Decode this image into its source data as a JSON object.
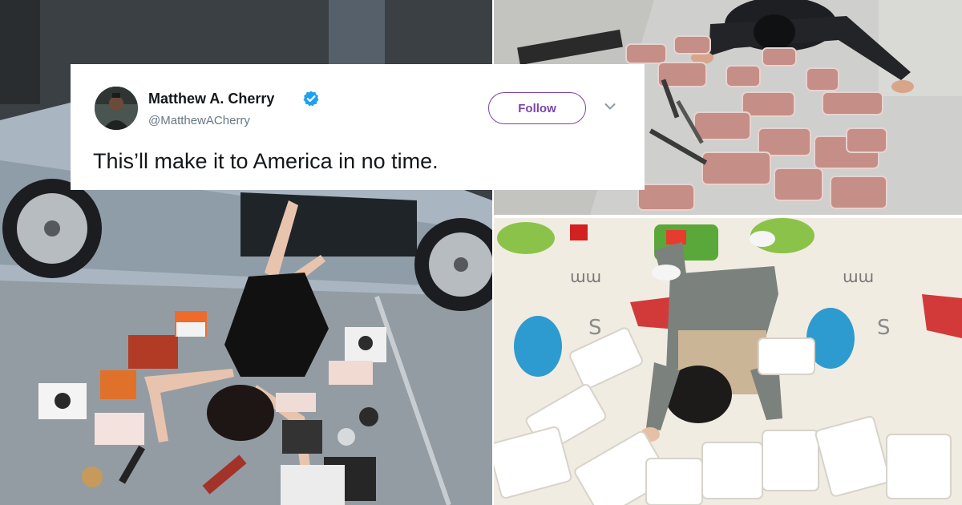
{
  "tweet": {
    "author_name": "Matthew A. Cherry",
    "author_handle": "@MatthewACherry",
    "follow_label": "Follow",
    "text": "This’ll make it to America in no time.",
    "avatar_icon": "person-avatar-icon",
    "verified_icon": "verified-badge-icon",
    "menu_icon": "chevron-down-icon"
  },
  "photos": [
    {
      "name": "photo-woman-by-sports-car"
    },
    {
      "name": "photo-man-with-meat"
    },
    {
      "name": "photo-baby-with-diapers"
    }
  ],
  "colors": {
    "accent": "#7b45a9",
    "verified": "#1da1f2",
    "name_text": "#14171a",
    "handle_text": "#657786"
  }
}
